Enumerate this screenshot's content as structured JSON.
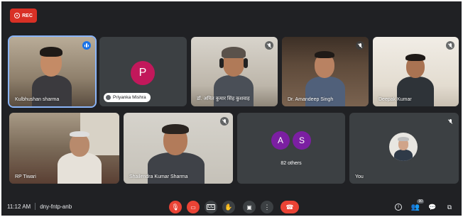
{
  "recording": {
    "label": "REC",
    "color": "#d93025"
  },
  "participants": [
    {
      "name": "Kulbhushan sharma",
      "state": "speaking"
    },
    {
      "name": "Priyanka Mishra",
      "initial": "P",
      "avatar_color": "#c2185b",
      "state": "muted"
    },
    {
      "name": "डॉ. अमित कुमार सिंह कुशवाह",
      "state": "muted"
    },
    {
      "name": "Dr. Amandeep Singh",
      "state": "muted"
    },
    {
      "name": "Deepak Kumar",
      "state": "muted"
    },
    {
      "name": "RP Tiwari",
      "state": "muted"
    },
    {
      "name": "Shailendra Kumar Sharma",
      "state": "muted"
    },
    {
      "name": "You",
      "state": "muted"
    }
  ],
  "others_tile": {
    "initials": [
      "A",
      "S"
    ],
    "avatar_color": "#7b1fa2",
    "label": "82 others"
  },
  "bottom_bar": {
    "time": "11:12 AM",
    "meeting_code": "dny-fntp-anb",
    "controls": [
      "mic-off",
      "camera-off",
      "captions",
      "raise-hand",
      "present",
      "more",
      "end-call"
    ],
    "people_count": "90",
    "accent_red": "#ea4335"
  }
}
